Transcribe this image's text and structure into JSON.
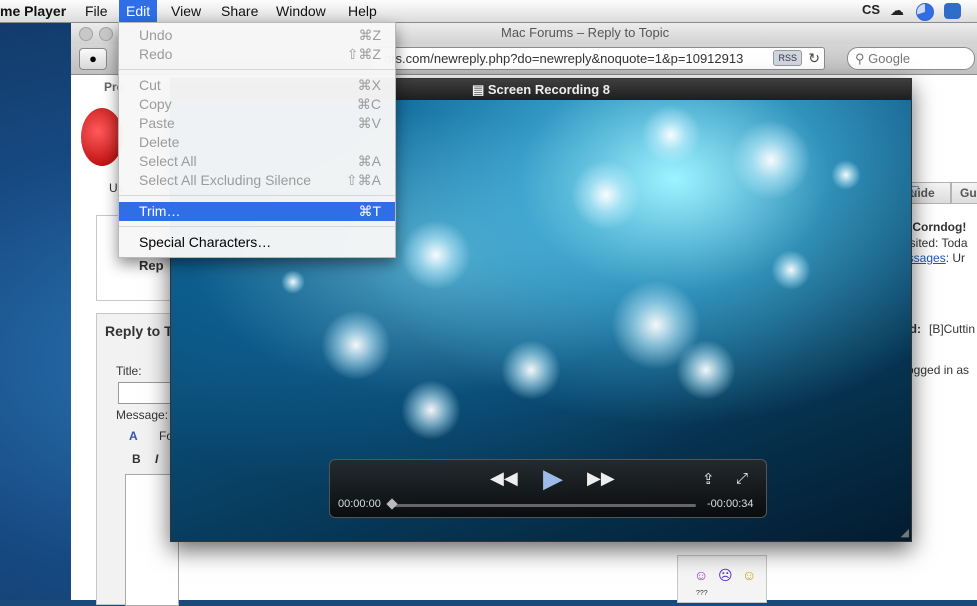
{
  "menubar": {
    "app_name": "me Player",
    "items": [
      "File",
      "Edit",
      "View",
      "Share",
      "Window",
      "Help"
    ],
    "tray_text": "CS"
  },
  "browser": {
    "window_title": "Mac Forums – Reply to Topic",
    "url": "ors.com/newreply.php?do=newreply&noquote=1&p=10912913",
    "rss_label": "RSS",
    "search_placeholder": "Google",
    "page": {
      "fragment_pro": "Pro",
      "fragment_us": "Us",
      "tab_guide": "uide",
      "tab_gu": "Gu",
      "greeting": "e, Corndog!",
      "visited": "visited: Toda",
      "messages_link": "essages",
      "messages_suffix": ": Ur",
      "rep_label": "Rep",
      "reply_to": "Reply to T",
      "thread_label": "ad:",
      "thread_value": "[B]Cuttin",
      "logged_in": "ogged in as",
      "title_label": "Title:",
      "message_label": "Message:",
      "font_label": "Fo",
      "bold_label": "B",
      "italic_label": "I",
      "smilie_extra": "???"
    }
  },
  "edit_menu": {
    "items": [
      {
        "label": "Undo",
        "shortcut": "⌘Z",
        "enabled": false
      },
      {
        "label": "Redo",
        "shortcut": "⇧⌘Z",
        "enabled": false
      },
      {
        "label": "Cut",
        "shortcut": "⌘X",
        "enabled": false
      },
      {
        "label": "Copy",
        "shortcut": "⌘C",
        "enabled": false
      },
      {
        "label": "Paste",
        "shortcut": "⌘V",
        "enabled": false
      },
      {
        "label": "Delete",
        "shortcut": "",
        "enabled": false
      },
      {
        "label": "Select All",
        "shortcut": "⌘A",
        "enabled": false
      },
      {
        "label": "Select All Excluding Silence",
        "shortcut": "⇧⌘A",
        "enabled": false
      },
      {
        "label": "Trim…",
        "shortcut": "⌘T",
        "enabled": true,
        "selected": true
      },
      {
        "label": "Special Characters…",
        "shortcut": "",
        "enabled": true
      }
    ]
  },
  "player": {
    "title": "Screen Recording 8",
    "elapsed": "00:00:00",
    "remaining": "-00:00:34",
    "progress": 0
  }
}
